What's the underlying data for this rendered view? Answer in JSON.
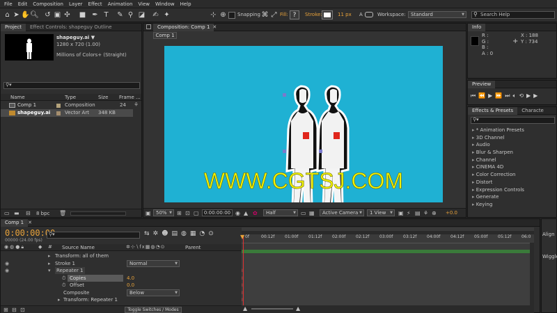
{
  "menubar": {
    "items": [
      "File",
      "Edit",
      "Composition",
      "Layer",
      "Effect",
      "Animation",
      "View",
      "Window",
      "Help"
    ]
  },
  "toolbar": {
    "snapping_label": "Snapping",
    "fill_label": "Fill:",
    "stroke_label": "Stroke:",
    "stroke_width": "11 px",
    "add_label": "A",
    "workspace_label": "Workspace:",
    "workspace_value": "Standard",
    "search_placeholder": "Search Help"
  },
  "project_panel": {
    "tabs": [
      "Project",
      "Effect Controls: shapeguy Outline"
    ],
    "item_name": "shapeguy.ai ▼",
    "item_dims": "1280 x 720 (1.00)",
    "item_colors": "Millions of Colors+ (Straight)",
    "columns": [
      "Name",
      "Type",
      "Size",
      "Frame ..."
    ],
    "items": [
      {
        "name": "Comp 1",
        "type": "Composition",
        "size": "",
        "frame": "24"
      },
      {
        "name": "shapeguy.ai",
        "type": "Vector Art",
        "size": "348 KB",
        "frame": ""
      }
    ],
    "bpc": "8 bpc"
  },
  "composition_panel": {
    "tab": "Composition: Comp 1",
    "subtab": "Comp 1",
    "watermark": "WWW.CGTSJ.COM",
    "bg_color": "#1fb1d3",
    "zoom": "50%",
    "timecode": "0:00:00:00",
    "resolution": "Half",
    "camera": "Active Camera",
    "views": "1 View",
    "exposure": "+0.0"
  },
  "info_panel": {
    "tab": "Info",
    "r": "R :",
    "g": "G :",
    "b": "B :",
    "a": "A : 0",
    "x": "X : 188",
    "y": "Y : 734"
  },
  "preview_panel": {
    "tab": "Preview"
  },
  "effects_panel": {
    "tabs": [
      "Effects & Presets",
      "Characte"
    ],
    "items": [
      "* Animation Presets",
      "3D Channel",
      "Audio",
      "Blur & Sharpen",
      "Channel",
      "CINEMA 4D",
      "Color Correction",
      "Distort",
      "Expression Controls",
      "Generate",
      "Keying"
    ]
  },
  "timeline": {
    "tab": "Comp 1",
    "timecode": "0:00:00:00",
    "fps": "00000 (24.00 fps)",
    "col_source": "Source Name",
    "col_parent": "Parent",
    "ruler": [
      "0f",
      "00:12f",
      "01:00f",
      "01:12f",
      "02:00f",
      "02:12f",
      "03:00f",
      "03:12f",
      "04:00f",
      "04:12f",
      "05:00f",
      "05:12f",
      "06:0"
    ],
    "layers": [
      {
        "name": "Transform: all of them",
        "value": ""
      },
      {
        "name": "Stroke 1",
        "value": "Normal"
      },
      {
        "name": "Repeater 1",
        "value": ""
      },
      {
        "name": "Copies",
        "value": "4.0"
      },
      {
        "name": "Offset",
        "value": "0.0"
      },
      {
        "name": "Composite",
        "value": "Below"
      },
      {
        "name": "Transform: Repeater 1",
        "value": ""
      }
    ],
    "toggle_label": "Toggle Switches / Modes"
  },
  "right_edge": {
    "align": "Align",
    "wiggler": "Wiggler"
  }
}
